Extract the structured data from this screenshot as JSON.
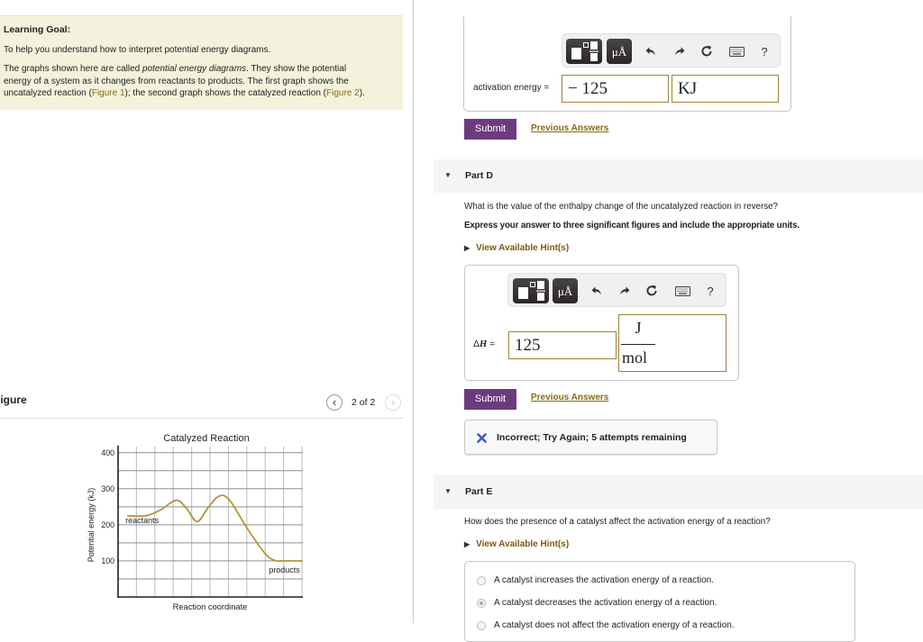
{
  "learning_goal": {
    "heading": "Learning Goal:",
    "intro": "To help you understand how to interpret potential energy diagrams.",
    "paragraph": {
      "line1_pre": "The graphs shown here are called ",
      "line1_italic": "potential energy diagrams",
      "line1_post": ". They show the potential",
      "line2": "energy of a system as it changes from reactants to products. The first graph shows the",
      "line3_pre": "uncatalyzed reaction (",
      "link_figure1": "Figure 1",
      "line3_mid": "); the second graph shows the catalyzed reaction (",
      "link_figure2": "Figure 2",
      "line3_post": ")."
    }
  },
  "figure_panel": {
    "title": "Figure",
    "pager_text": "2 of 2",
    "prev_glyph": "‹",
    "next_glyph": "›"
  },
  "chart_data": {
    "type": "line",
    "title": "Catalyzed Reaction",
    "xlabel": "Reaction coordinate",
    "ylabel": "Potential energy (kJ)",
    "xlim": [
      0,
      10
    ],
    "ylim": [
      0,
      400
    ],
    "yticks": [
      100,
      200,
      300,
      400
    ],
    "y_gridlines": [
      50,
      100,
      150,
      200,
      250,
      300,
      350,
      400
    ],
    "x_gridlines": [
      1,
      2,
      3,
      4,
      5,
      6,
      7,
      8,
      9,
      10
    ],
    "grid": true,
    "series": [
      {
        "name": "Catalyzed reaction",
        "points": [
          [
            0.5,
            225
          ],
          [
            1.5,
            225
          ],
          [
            2.3,
            241
          ],
          [
            3.15,
            268
          ],
          [
            3.7,
            247
          ],
          [
            4.3,
            209
          ],
          [
            4.9,
            248
          ],
          [
            5.5,
            280
          ],
          [
            6.05,
            269
          ],
          [
            7.0,
            192
          ],
          [
            8.0,
            120
          ],
          [
            8.55,
            101
          ],
          [
            9.0,
            100
          ],
          [
            10.0,
            100
          ]
        ]
      }
    ],
    "key_levels_kJ": {
      "reactants": 225,
      "first_peak": 268,
      "intermediate": 209,
      "second_peak": 280,
      "products": 100
    },
    "annotations": [
      {
        "text": "reactants",
        "x": 0.4,
        "y": 205
      },
      {
        "text": "products",
        "x": 8.2,
        "y": 67
      }
    ]
  },
  "toolbar": {
    "units_label": "μÅ",
    "help_label": "?"
  },
  "part_c": {
    "answer_label": "activation energy =",
    "value": "− 125",
    "unit": "KJ",
    "submit": "Submit",
    "previous_answers": "Previous Answers"
  },
  "part_d": {
    "header": "Part D",
    "question": "What is the value of the enthalpy change of the uncatalyzed reaction in reverse?",
    "instruction": "Express your answer to three significant figures and include the appropriate units.",
    "hint": "View Available Hint(s)",
    "answer_label_delta": "Δ",
    "answer_label_var": "H",
    "answer_label_eq": " =",
    "value": "125",
    "unit_numerator": "J",
    "unit_denominator": "mol",
    "submit": "Submit",
    "previous_answers": "Previous Answers",
    "feedback": {
      "status": "incorrect",
      "text": "Incorrect; Try Again; 5 attempts remaining"
    }
  },
  "part_e": {
    "header": "Part E",
    "question": "How does the presence of a catalyst affect the activation energy of a reaction?",
    "hint": "View Available Hint(s)",
    "options": [
      {
        "label": "A catalyst increases the activation energy of a reaction.",
        "selected": false
      },
      {
        "label": "A catalyst decreases the activation energy of a reaction.",
        "selected": true
      },
      {
        "label": "A catalyst does not affect the activation energy of a reaction.",
        "selected": false
      }
    ]
  },
  "colors": {
    "goal-bg": "#f4f2dc",
    "link": "#8a6a14",
    "submit-bg": "#6c3b7e",
    "input-border": "#a08536",
    "part-bg": "#f5f5f5",
    "x-icon": "#3b5bd6",
    "divider": "#d9c7ae",
    "curve": "#b28f2f"
  }
}
